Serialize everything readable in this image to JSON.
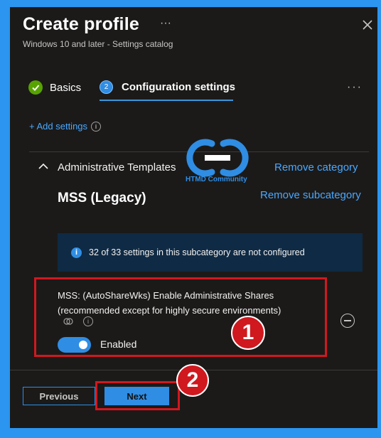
{
  "header": {
    "title": "Create profile",
    "title_more": "···",
    "subtitle": "Windows 10 and later - Settings catalog"
  },
  "steps": [
    {
      "label": "Basics",
      "number": ""
    },
    {
      "label": "Configuration settings",
      "number": "2"
    }
  ],
  "steps_more": "···",
  "add_settings": "+ Add settings",
  "logo": {
    "text": "HTMD Community"
  },
  "category": {
    "title": "Administrative Templates",
    "remove_category": "Remove category",
    "subcategory": "MSS (Legacy)",
    "remove_subcategory": "Remove subcategory"
  },
  "info_bar": {
    "text": "32 of 33 settings in this subcategory are not configured"
  },
  "setting": {
    "name": "MSS: (AutoShareWks) Enable Administrative Shares (recommended except for highly secure environments)",
    "toggle_label": "Enabled"
  },
  "annotations": {
    "badge1": "1",
    "badge2": "2"
  },
  "footer": {
    "previous": "Previous",
    "next": "Next"
  },
  "colors": {
    "accent": "#2f8de4",
    "highlight": "#d0181f",
    "frame": "#2b95f0"
  }
}
